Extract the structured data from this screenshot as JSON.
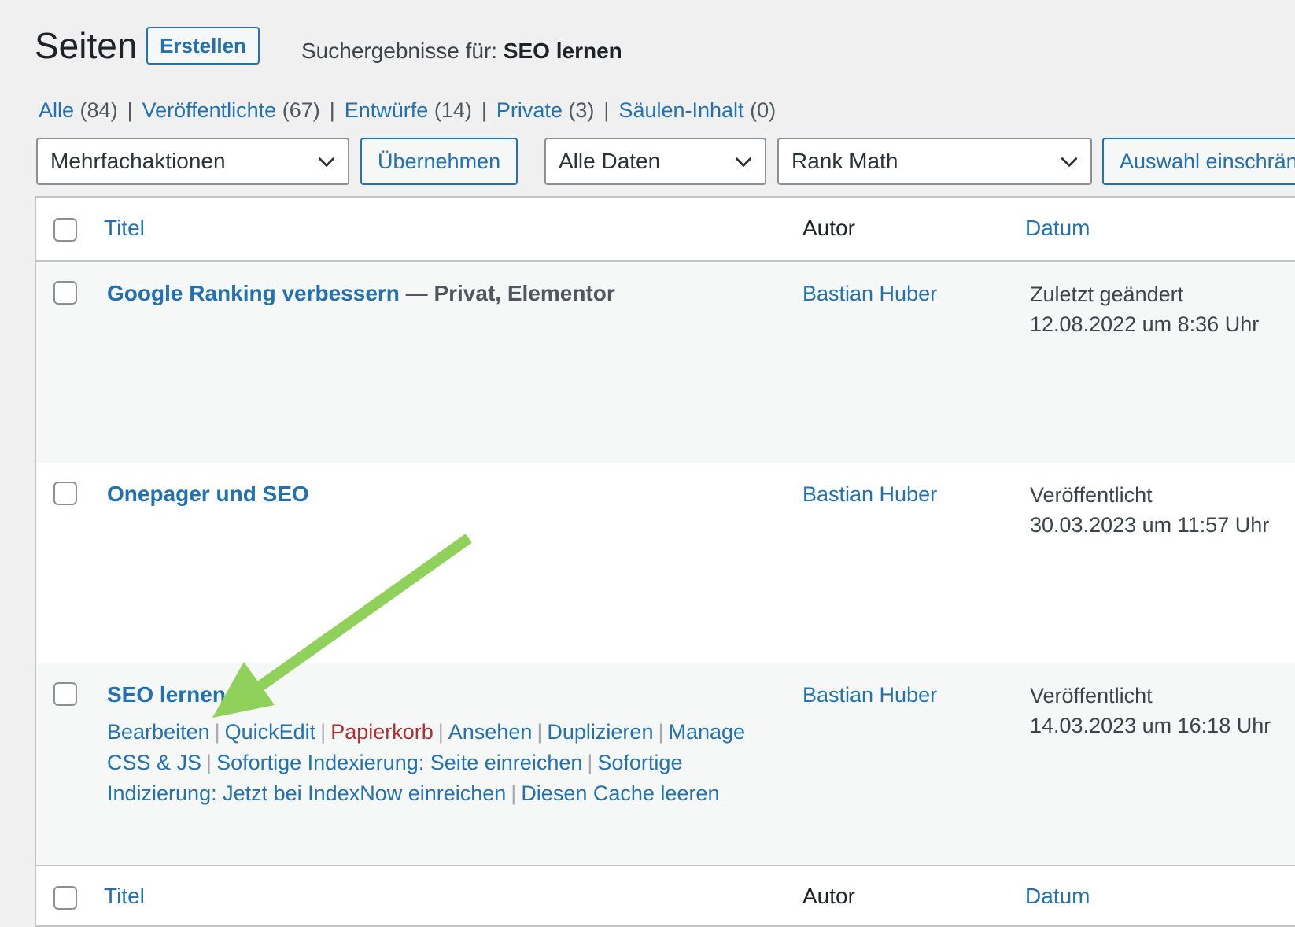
{
  "header": {
    "title": "Seiten",
    "create_label": "Erstellen",
    "search_prefix": "Suchergebnisse für: ",
    "search_term": "SEO lernen"
  },
  "views": [
    {
      "label": "Alle",
      "count": "(84)"
    },
    {
      "label": "Veröffentlichte",
      "count": "(67)"
    },
    {
      "label": "Entwürfe",
      "count": "(14)"
    },
    {
      "label": "Private",
      "count": "(3)"
    },
    {
      "label": "Säulen-Inhalt",
      "count": "(0)"
    }
  ],
  "tablenav": {
    "bulk_select": "Mehrfachaktionen",
    "apply_label": "Übernehmen",
    "date_select": "Alle Daten",
    "seo_select": "Rank Math",
    "filter_label": "Auswahl einschränken"
  },
  "columns": {
    "title": "Titel",
    "author": "Autor",
    "date": "Datum"
  },
  "rows": [
    {
      "title": "Google Ranking verbessern",
      "state": " — Privat, Elementor",
      "author": "Bastian Huber",
      "date_status": "Zuletzt geändert",
      "date_value": "12.08.2022 um 8:36 Uhr"
    },
    {
      "title": "Onepager und SEO",
      "state": "",
      "author": "Bastian Huber",
      "date_status": "Veröffentlicht",
      "date_value": "30.03.2023 um 11:57 Uhr"
    },
    {
      "title": "SEO lernen",
      "state": "",
      "author": "Bastian Huber",
      "date_status": "Veröffentlicht",
      "date_value": "14.03.2023 um 16:18 Uhr",
      "actions": [
        "Bearbeiten",
        "QuickEdit",
        "Papierkorb",
        "Ansehen",
        "Duplizieren",
        "Manage CSS & JS",
        "Sofortige Indexierung: Seite einreichen",
        "Sofortige Indizierung: Jetzt bei IndexNow einreichen",
        "Diesen Cache leeren"
      ]
    }
  ],
  "colors": {
    "link": "#2271b1",
    "trash": "#b32d2e",
    "arrow": "#8fd15a",
    "background": "#f0f0f1"
  }
}
